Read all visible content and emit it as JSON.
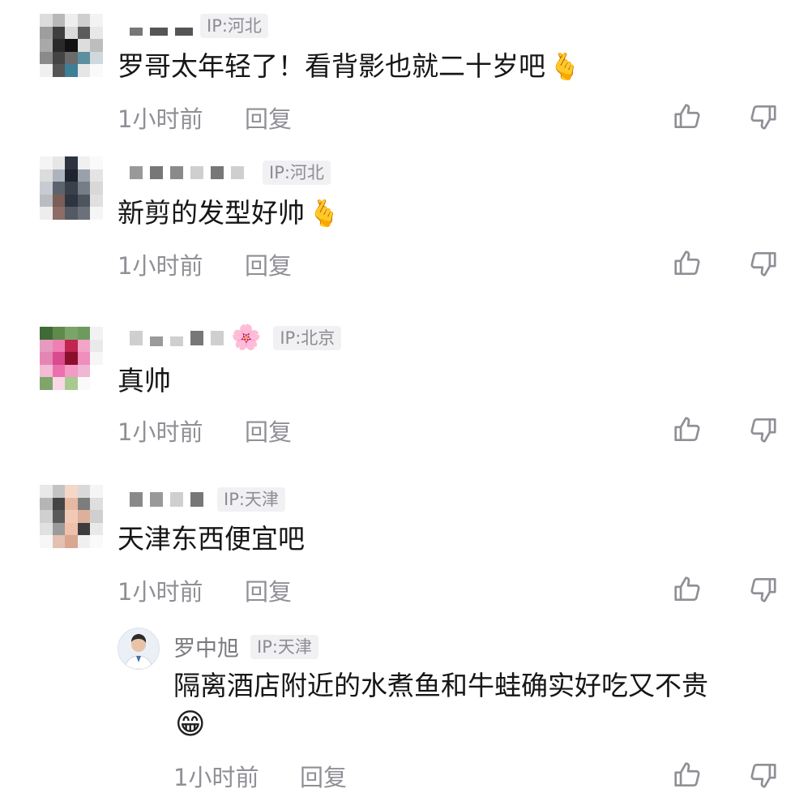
{
  "comments": [
    {
      "ip": "IP:河北",
      "text": "罗哥太年轻了！看背影也就二十岁吧",
      "time": "1小时前",
      "reply": "回复",
      "emoji": "🫰"
    },
    {
      "ip": "IP:河北",
      "text": "新剪的发型好帅",
      "time": "1小时前",
      "reply": "回复",
      "emoji": "🫰"
    },
    {
      "ip": "IP:北京",
      "text": "真帅",
      "time": "1小时前",
      "reply": "回复",
      "name_emoji": "🌸"
    },
    {
      "ip": "IP:天津",
      "text": "天津东西便宜吧",
      "time": "1小时前",
      "reply": "回复"
    }
  ],
  "subreply": {
    "name": "罗中旭",
    "ip": "IP:天津",
    "line1": "隔离酒店附近的水煮鱼和牛蛙确实好吃又不贵",
    "emoji": "😁",
    "time": "1小时前",
    "reply": "回复"
  },
  "icons": {
    "like": "thumbs-up-icon",
    "dislike": "thumbs-down-icon"
  },
  "colors": {
    "text": "#161616",
    "meta": "#8f8f96",
    "ip_bg": "#f1f1f3",
    "ip_text": "#8c8c94"
  }
}
